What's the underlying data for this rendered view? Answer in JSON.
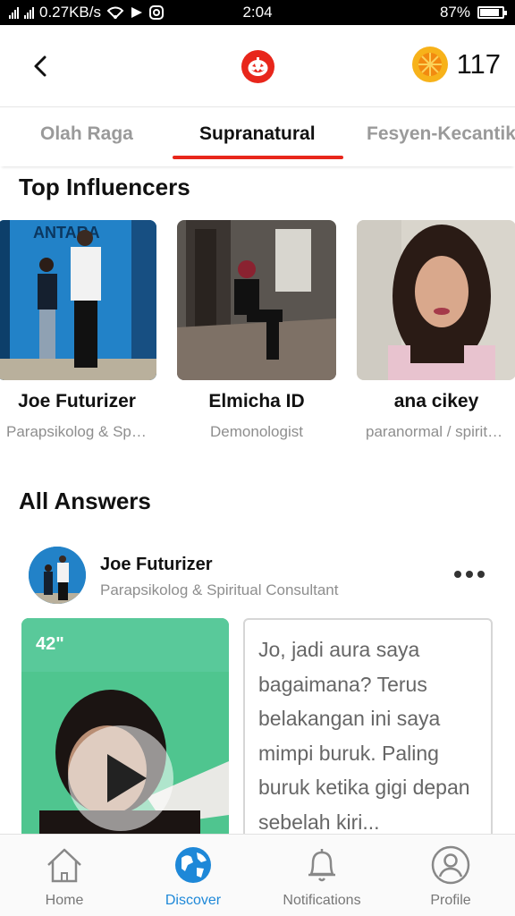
{
  "status_bar": {
    "speed": "0.27KB/s",
    "time": "2:04",
    "battery": "87%",
    "battery_level": 0.87
  },
  "header": {
    "back_icon": "chevron-left-icon",
    "logo_icon": "pumpkin-icon",
    "coin_icon": "orange-slice-coin-icon",
    "coin_count": "117",
    "accent_color": "#e8261b"
  },
  "tabs": [
    {
      "label": "Olah Raga",
      "active": false
    },
    {
      "label": "Supranatural",
      "active": true
    },
    {
      "label": "Fesyen-Kecantikan",
      "active": false
    }
  ],
  "top_influencers": {
    "title": "Top Influencers",
    "items": [
      {
        "name": "Joe Futurizer",
        "role": "Parapsikolog & Spiritual Consultant",
        "backdrop_text": "ANTARA"
      },
      {
        "name": "Elmicha ID",
        "role": "Demonologist"
      },
      {
        "name": "ana cikey",
        "role": "paranormal / spiritual"
      }
    ]
  },
  "all_answers": {
    "title": "All Answers",
    "items": [
      {
        "author": "Joe Futurizer",
        "role": "Parapsikolog & Spiritual Consultant",
        "video_duration": "42\"",
        "question": "Jo, jadi aura saya bagaimana? Terus belakangan ini saya mimpi buruk. Paling buruk ketika gigi depan sebelah kiri..."
      }
    ]
  },
  "bottom_nav": {
    "active_color": "#1e88d8",
    "items": [
      {
        "label": "Home",
        "icon": "home-icon",
        "active": false
      },
      {
        "label": "Discover",
        "icon": "globe-icon",
        "active": true
      },
      {
        "label": "Notifications",
        "icon": "bell-icon",
        "active": false
      },
      {
        "label": "Profile",
        "icon": "profile-icon",
        "active": false
      }
    ]
  }
}
